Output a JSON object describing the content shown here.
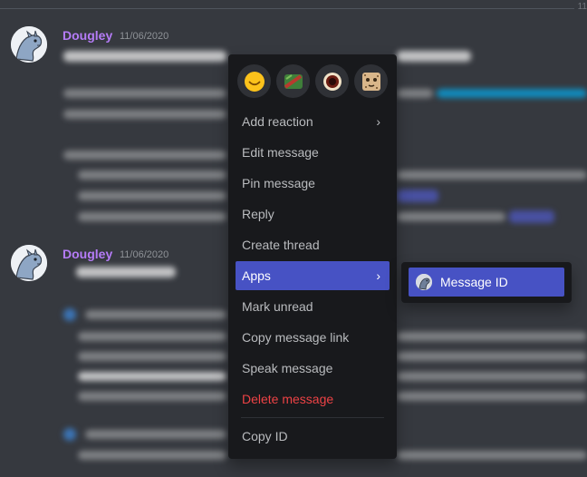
{
  "header": {
    "divider_count": "11"
  },
  "messages": [
    {
      "author": "Dougley",
      "timestamp": "11/06/2020"
    },
    {
      "author": "Dougley",
      "timestamp": "11/06/2020"
    }
  ],
  "reactions": [
    {
      "icon": "smile-emoji-icon"
    },
    {
      "icon": "custom-emoji-1-icon"
    },
    {
      "icon": "custom-emoji-2-icon"
    },
    {
      "icon": "custom-emoji-3-icon"
    }
  ],
  "context_menu": {
    "add_reaction": "Add reaction",
    "edit_message": "Edit message",
    "pin_message": "Pin message",
    "reply": "Reply",
    "create_thread": "Create thread",
    "apps": "Apps",
    "mark_unread": "Mark unread",
    "copy_message_link": "Copy message link",
    "speak_message": "Speak message",
    "delete_message": "Delete message",
    "copy_id": "Copy ID",
    "chevron": "›"
  },
  "apps_submenu": {
    "message_id": "Message ID"
  },
  "colors": {
    "background": "#36393f",
    "menu": "#18191c",
    "highlight": "#4752c4",
    "username": "#b57cf7",
    "danger": "#ed4245"
  }
}
